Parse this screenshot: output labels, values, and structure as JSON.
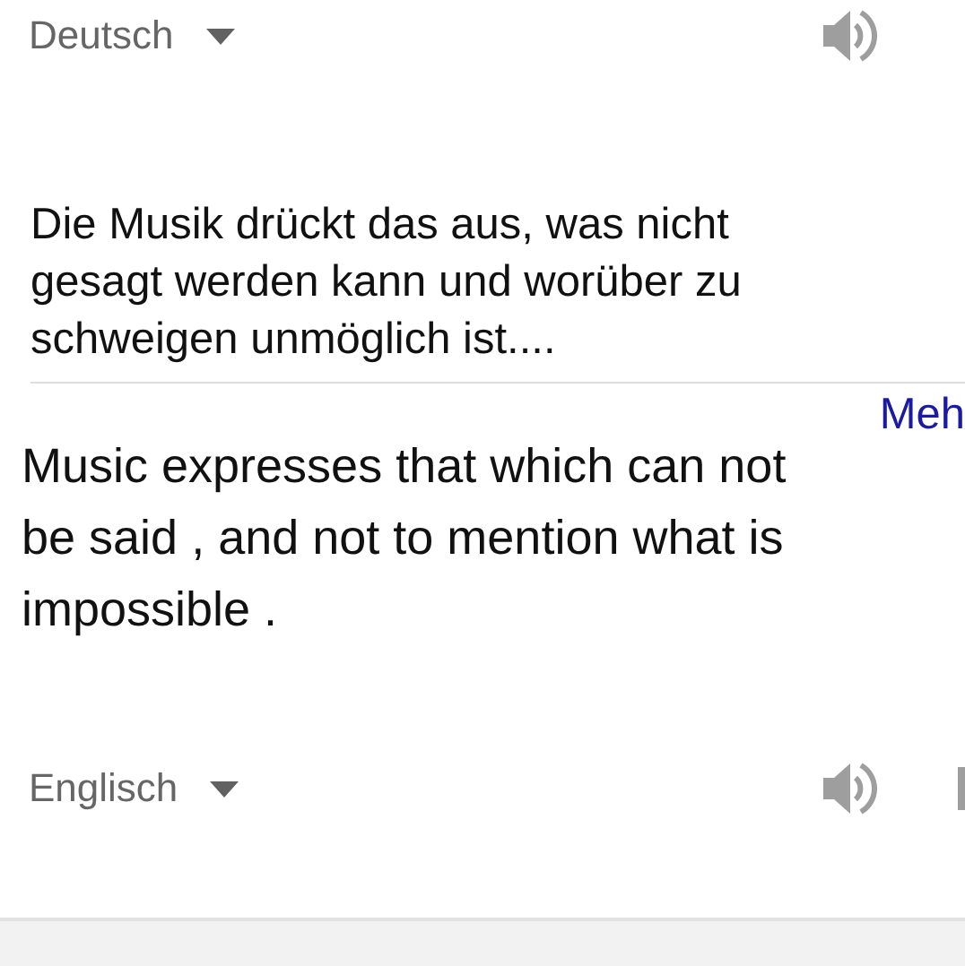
{
  "source": {
    "language": "Deutsch",
    "lines": [
      "Die Musik drückt das aus, was nicht",
      "gesagt werden kann und worüber zu",
      "schweigen unmöglich ist...."
    ],
    "more_link": "Meh"
  },
  "translation": {
    "lines": [
      "Music expresses that which can not",
      "be said , and not to mention what is",
      "impossible ."
    ],
    "language": "Englisch"
  }
}
